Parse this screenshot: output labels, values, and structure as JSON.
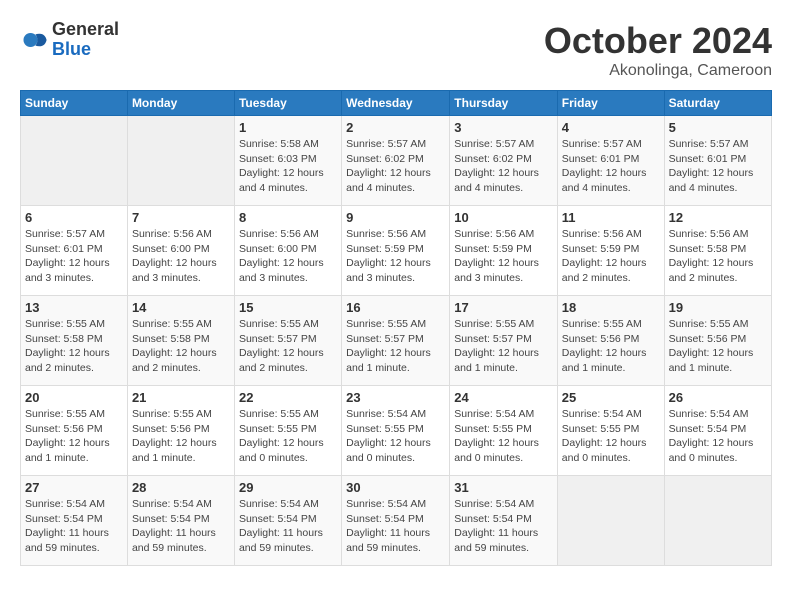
{
  "header": {
    "logo_general": "General",
    "logo_blue": "Blue",
    "month_title": "October 2024",
    "location": "Akonolinga, Cameroon"
  },
  "weekdays": [
    "Sunday",
    "Monday",
    "Tuesday",
    "Wednesday",
    "Thursday",
    "Friday",
    "Saturday"
  ],
  "days": {
    "1": {
      "sunrise": "5:58 AM",
      "sunset": "6:03 PM",
      "daylight": "12 hours and 4 minutes."
    },
    "2": {
      "sunrise": "5:57 AM",
      "sunset": "6:02 PM",
      "daylight": "12 hours and 4 minutes."
    },
    "3": {
      "sunrise": "5:57 AM",
      "sunset": "6:02 PM",
      "daylight": "12 hours and 4 minutes."
    },
    "4": {
      "sunrise": "5:57 AM",
      "sunset": "6:01 PM",
      "daylight": "12 hours and 4 minutes."
    },
    "5": {
      "sunrise": "5:57 AM",
      "sunset": "6:01 PM",
      "daylight": "12 hours and 4 minutes."
    },
    "6": {
      "sunrise": "5:57 AM",
      "sunset": "6:01 PM",
      "daylight": "12 hours and 3 minutes."
    },
    "7": {
      "sunrise": "5:56 AM",
      "sunset": "6:00 PM",
      "daylight": "12 hours and 3 minutes."
    },
    "8": {
      "sunrise": "5:56 AM",
      "sunset": "6:00 PM",
      "daylight": "12 hours and 3 minutes."
    },
    "9": {
      "sunrise": "5:56 AM",
      "sunset": "5:59 PM",
      "daylight": "12 hours and 3 minutes."
    },
    "10": {
      "sunrise": "5:56 AM",
      "sunset": "5:59 PM",
      "daylight": "12 hours and 3 minutes."
    },
    "11": {
      "sunrise": "5:56 AM",
      "sunset": "5:59 PM",
      "daylight": "12 hours and 2 minutes."
    },
    "12": {
      "sunrise": "5:56 AM",
      "sunset": "5:58 PM",
      "daylight": "12 hours and 2 minutes."
    },
    "13": {
      "sunrise": "5:55 AM",
      "sunset": "5:58 PM",
      "daylight": "12 hours and 2 minutes."
    },
    "14": {
      "sunrise": "5:55 AM",
      "sunset": "5:58 PM",
      "daylight": "12 hours and 2 minutes."
    },
    "15": {
      "sunrise": "5:55 AM",
      "sunset": "5:57 PM",
      "daylight": "12 hours and 2 minutes."
    },
    "16": {
      "sunrise": "5:55 AM",
      "sunset": "5:57 PM",
      "daylight": "12 hours and 1 minute."
    },
    "17": {
      "sunrise": "5:55 AM",
      "sunset": "5:57 PM",
      "daylight": "12 hours and 1 minute."
    },
    "18": {
      "sunrise": "5:55 AM",
      "sunset": "5:56 PM",
      "daylight": "12 hours and 1 minute."
    },
    "19": {
      "sunrise": "5:55 AM",
      "sunset": "5:56 PM",
      "daylight": "12 hours and 1 minute."
    },
    "20": {
      "sunrise": "5:55 AM",
      "sunset": "5:56 PM",
      "daylight": "12 hours and 1 minute."
    },
    "21": {
      "sunrise": "5:55 AM",
      "sunset": "5:56 PM",
      "daylight": "12 hours and 1 minute."
    },
    "22": {
      "sunrise": "5:55 AM",
      "sunset": "5:55 PM",
      "daylight": "12 hours and 0 minutes."
    },
    "23": {
      "sunrise": "5:54 AM",
      "sunset": "5:55 PM",
      "daylight": "12 hours and 0 minutes."
    },
    "24": {
      "sunrise": "5:54 AM",
      "sunset": "5:55 PM",
      "daylight": "12 hours and 0 minutes."
    },
    "25": {
      "sunrise": "5:54 AM",
      "sunset": "5:55 PM",
      "daylight": "12 hours and 0 minutes."
    },
    "26": {
      "sunrise": "5:54 AM",
      "sunset": "5:54 PM",
      "daylight": "12 hours and 0 minutes."
    },
    "27": {
      "sunrise": "5:54 AM",
      "sunset": "5:54 PM",
      "daylight": "11 hours and 59 minutes."
    },
    "28": {
      "sunrise": "5:54 AM",
      "sunset": "5:54 PM",
      "daylight": "11 hours and 59 minutes."
    },
    "29": {
      "sunrise": "5:54 AM",
      "sunset": "5:54 PM",
      "daylight": "11 hours and 59 minutes."
    },
    "30": {
      "sunrise": "5:54 AM",
      "sunset": "5:54 PM",
      "daylight": "11 hours and 59 minutes."
    },
    "31": {
      "sunrise": "5:54 AM",
      "sunset": "5:54 PM",
      "daylight": "11 hours and 59 minutes."
    }
  },
  "labels": {
    "sunrise": "Sunrise:",
    "sunset": "Sunset:",
    "daylight": "Daylight:"
  }
}
